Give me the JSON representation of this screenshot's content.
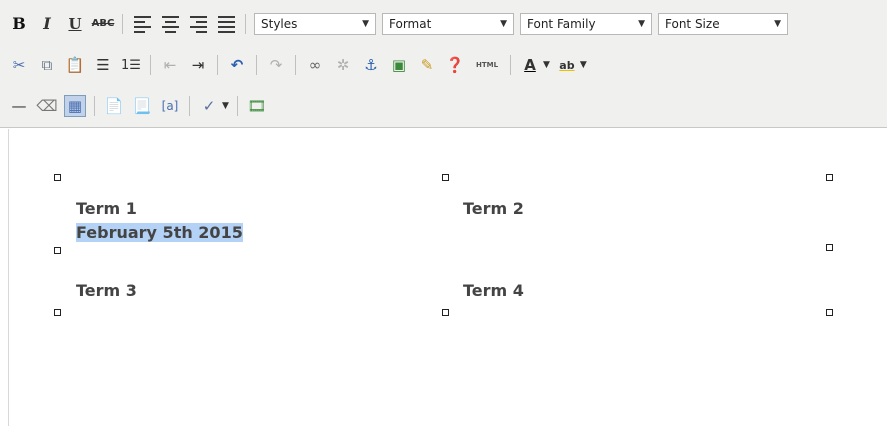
{
  "toolbar": {
    "styles_label": "Styles",
    "format_label": "Format",
    "font_family_label": "Font Family",
    "font_size_label": "Font Size",
    "bold_glyph": "B",
    "italic_glyph": "I",
    "underline_glyph": "U",
    "strike_glyph": "ABC",
    "html_glyph": "HTML",
    "font_color_glyph": "A",
    "text_hover_glyph": "ab"
  },
  "editor": {
    "table": {
      "rows": [
        [
          "Term 1",
          "Term 2"
        ],
        [
          "Term 3",
          "Term 4"
        ]
      ],
      "selected_text": "February 5th 2015"
    }
  },
  "colors": {
    "toolbar_bg": "#f0f0ee",
    "selection": "#b4d2f5",
    "accent_blue": "#2b5fb3"
  }
}
